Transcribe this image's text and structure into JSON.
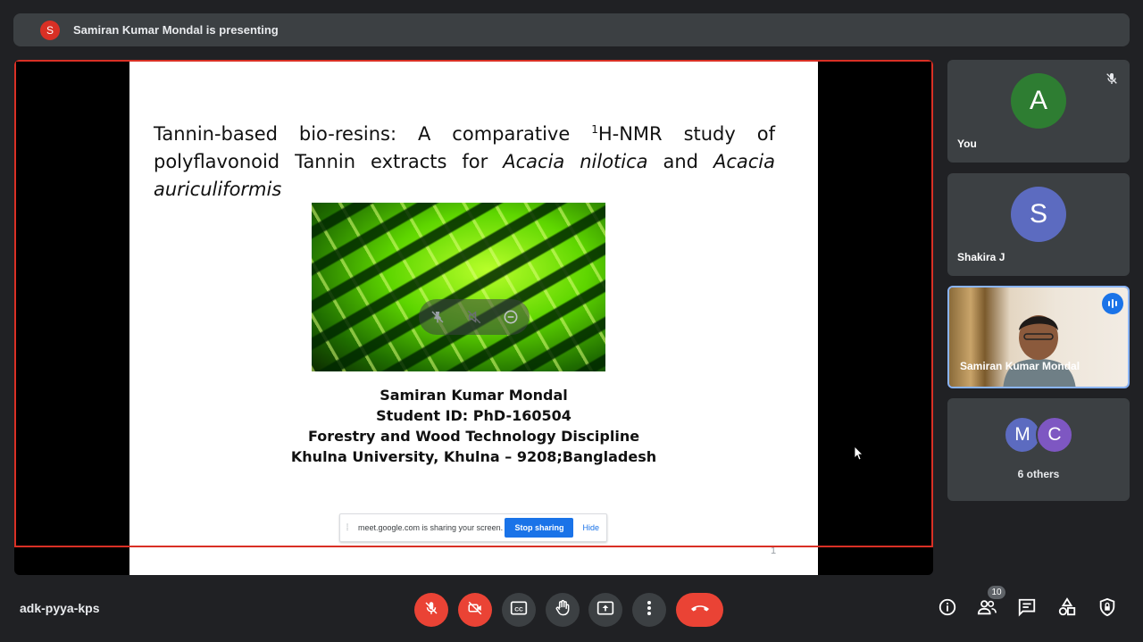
{
  "topbar": {
    "presenter_initial": "S",
    "presenting_text": "Samiran Kumar Mondal is presenting"
  },
  "slide": {
    "title_part1": "Tannin-based bio-resins: A comparative ",
    "title_sup": "1",
    "title_part2": "H-NMR study of polyflavonoid Tannin extracts for ",
    "title_italic1": "Acacia nilotica",
    "title_and": " and ",
    "title_italic2": "Acacia auriculiformis",
    "author": "Samiran Kumar Mondal",
    "student_id": "Student ID: PhD-160504",
    "discipline": "Forestry and Wood Technology Discipline",
    "university": "Khulna University, Khulna – 9208;Bangladesh",
    "page_number": "1"
  },
  "share_bar": {
    "message": "meet.google.com is sharing your screen.",
    "stop_label": "Stop sharing",
    "hide_label": "Hide"
  },
  "participants": [
    {
      "initial": "A",
      "name": "You",
      "color": "#2e7d32"
    },
    {
      "initial": "S",
      "name": "Shakira J",
      "color": "#5c6bc0"
    },
    {
      "name": "Samiran Kumar Mondal"
    }
  ],
  "others": {
    "initials": [
      "M",
      "C"
    ],
    "colors": [
      "#5c6bc0",
      "#7e57c2"
    ],
    "label": "6 others"
  },
  "bottom": {
    "meeting_code": "adk-pyya-kps",
    "participant_count": "10"
  },
  "icons": [
    "mic-off-icon",
    "camera-off-icon",
    "captions-icon",
    "raise-hand-icon",
    "present-icon",
    "more-icon",
    "end-call-icon",
    "info-icon",
    "people-icon",
    "chat-icon",
    "activities-icon",
    "host-controls-icon"
  ]
}
